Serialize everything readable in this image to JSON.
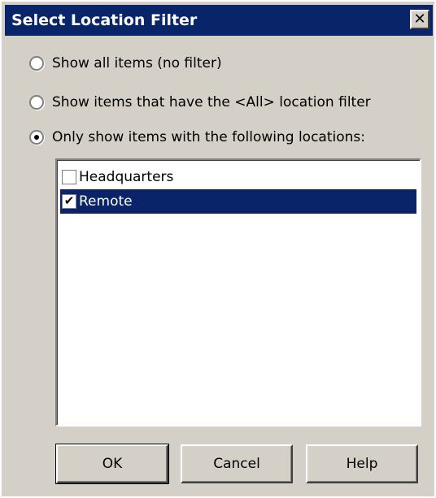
{
  "window": {
    "title": "Select Location Filter",
    "close_glyph": "✕"
  },
  "filter_options": [
    {
      "label": "Show all items (no filter)",
      "selected": false
    },
    {
      "label": "Show items that have the <All> location filter",
      "selected": false
    },
    {
      "label": "Only show items with the following locations:",
      "selected": true
    }
  ],
  "locations": [
    {
      "label": "Headquarters",
      "checked": false,
      "highlighted": false
    },
    {
      "label": "Remote",
      "checked": true,
      "highlighted": true
    }
  ],
  "buttons": {
    "ok": "OK",
    "cancel": "Cancel",
    "help": "Help"
  },
  "colors": {
    "title_bar": "#0a246a",
    "dialog_face": "#d4d0c8",
    "selection": "#0a246a"
  },
  "icons": {
    "close": "close-icon",
    "check": "checkmark-icon"
  }
}
